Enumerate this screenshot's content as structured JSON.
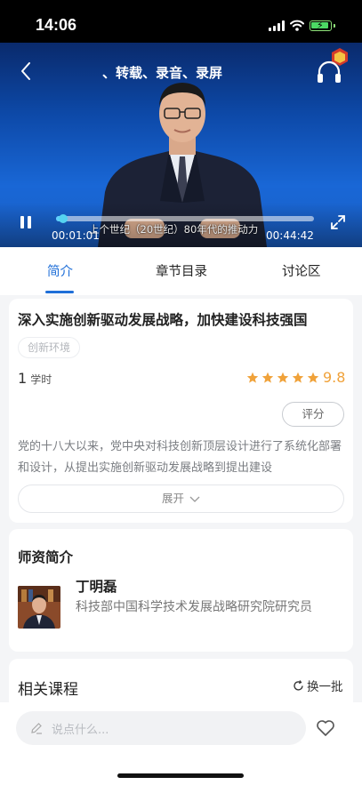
{
  "status_bar": {
    "time": "14:06"
  },
  "video": {
    "title": "、转载、录音、录屏",
    "subtitle": "上个世纪（20世纪）80年代的推动力",
    "time_current": "00:01:01",
    "time_total": "00:44:42",
    "progress": 0.023,
    "accent_color": "#5fd0ff",
    "icons": [
      "back-arrow-icon",
      "headphones-icon",
      "pause-icon",
      "fullscreen-icon"
    ]
  },
  "tabs": [
    {
      "label": "简介",
      "active": true
    },
    {
      "label": "章节目录",
      "active": false
    },
    {
      "label": "讨论区",
      "active": false
    }
  ],
  "course": {
    "title": "深入实施创新驱动发展战略，加快建设科技强国",
    "tag": "创新环境",
    "hours": "1",
    "hours_unit": "学时",
    "rating_stars": 5,
    "score": "9.8",
    "rate_label": "评分",
    "description": "党的十八大以来，党中央对科技创新顶层设计进行了系统化部署和设计，从提出实施创新驱动发展战略到提出建设",
    "expand_label": "展开"
  },
  "teacher": {
    "section_title": "师资简介",
    "name": "丁明磊",
    "bio": "科技部中国科学技术发展战略研究院研究员"
  },
  "related": {
    "title": "相关课程",
    "refresh_label": "换一批"
  },
  "comment": {
    "placeholder": "说点什么..."
  },
  "colors": {
    "brand_blue": "#1f6fd8",
    "star_orange": "#f0a23a"
  }
}
